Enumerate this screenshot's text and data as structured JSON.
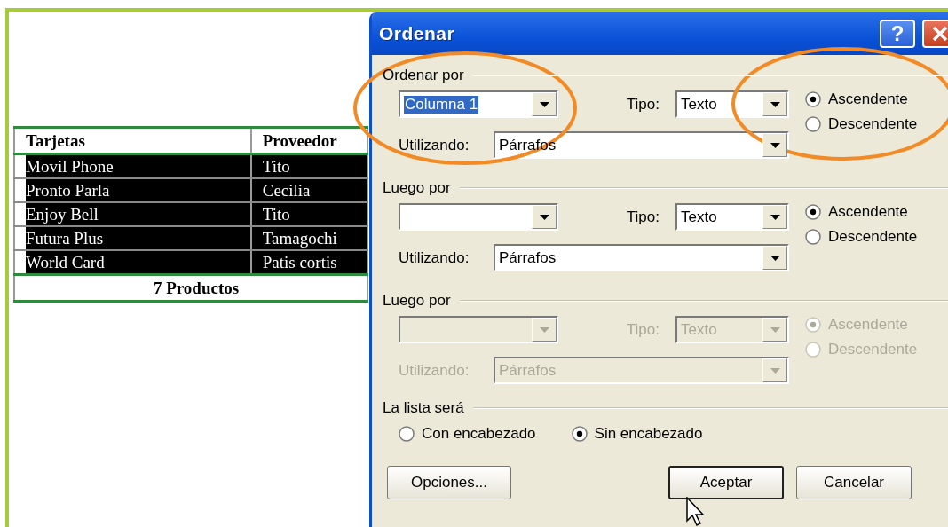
{
  "table": {
    "columns": [
      "Tarjetas",
      "Proveedor"
    ],
    "rows": [
      {
        "cells": [
          "Movil Phone",
          "Tito"
        ],
        "selected": true
      },
      {
        "cells": [
          "Pronto Parla",
          "Cecilia"
        ],
        "selected": true
      },
      {
        "cells": [
          "Enjoy Bell",
          "Tito"
        ],
        "selected": true
      },
      {
        "cells": [
          "Futura Plus",
          "Tamagochi"
        ],
        "selected": true
      },
      {
        "cells": [
          "World Card",
          "Patis cortis"
        ],
        "selected": true
      }
    ],
    "footer": "7 Productos"
  },
  "dialog": {
    "title": "Ordenar",
    "help_button": "?",
    "sections": [
      {
        "title": "Ordenar por",
        "disabled": false,
        "field": {
          "value": "Columna 1",
          "highlighted": true
        },
        "type_label": "Tipo:",
        "type_value": "Texto",
        "using_label": "Utilizando:",
        "using_value": "Párrafos",
        "options": [
          {
            "label": "Ascendente",
            "selected": true
          },
          {
            "label": "Descendente",
            "selected": false
          }
        ]
      },
      {
        "title": "Luego por",
        "disabled": false,
        "type_label": "Tipo:",
        "type_value": "Texto",
        "using_label": "Utilizando:",
        "using_value": "Párrafos",
        "options": [
          {
            "label": "Ascendente",
            "selected": true
          },
          {
            "label": "Descendente",
            "selected": false
          }
        ]
      },
      {
        "title": "Luego por",
        "disabled": true,
        "type_label": "Tipo:",
        "type_value": "Texto",
        "using_label": "Utilizando:",
        "using_value": "Párrafos",
        "options": [
          {
            "label": "Ascendente",
            "selected": true
          },
          {
            "label": "Descendente",
            "selected": false
          }
        ]
      }
    ],
    "list_section": {
      "title": "La lista será",
      "options": [
        {
          "label": "Con encabezado",
          "selected": false
        },
        {
          "label": "Sin encabezado",
          "selected": true
        }
      ]
    },
    "buttons": [
      {
        "label": "Opciones...",
        "default": false
      },
      {
        "label": "Aceptar",
        "default": true
      },
      {
        "label": "Cancelar",
        "default": false
      }
    ]
  }
}
